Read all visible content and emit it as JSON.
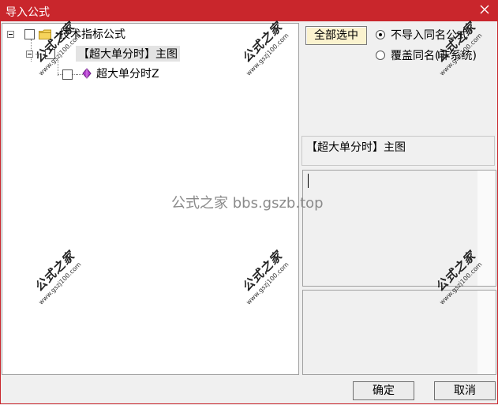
{
  "window": {
    "title": "导入公式",
    "close_icon": "close-icon",
    "title_bar_color": "#c9262c"
  },
  "tree": {
    "root": {
      "label": "技术指标公式",
      "icon": "folder-icon",
      "checked": false,
      "expanded": true
    },
    "group": {
      "label": "【超大单分时】主图",
      "checked": false,
      "expanded": true,
      "selected": true
    },
    "leaf": {
      "label": "超大单分时Z",
      "icon": "gem-icon",
      "checked": false
    }
  },
  "options": {
    "select_all_label": "全部选中",
    "radio_skip_label": "不导入同名公式",
    "radio_overwrite_label": "覆盖同名(非系统)",
    "selected_radio": "radio_skip"
  },
  "details": {
    "name": "【超大单分时】主图",
    "description": ""
  },
  "footer": {
    "ok_label": "确定",
    "cancel_label": "取消"
  },
  "watermarks": {
    "stamp_text": "公式之家",
    "stamp_url": "www.gszj100.com",
    "center_text": "公式之家 bbs.gszb.top"
  }
}
